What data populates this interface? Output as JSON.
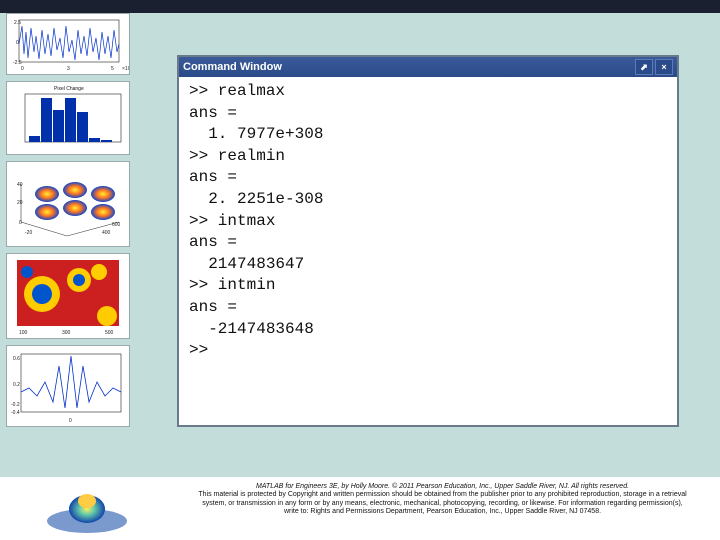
{
  "command_window": {
    "title": "Command Window",
    "dock_label": "⬈",
    "close_label": "×",
    "lines": [
      ">> realmax",
      "ans =",
      "  1. 7977e+308",
      ">> realmin",
      "ans =",
      "  2. 2251e-308",
      ">> intmax",
      "ans =",
      "  2147483647",
      ">> intmin",
      "ans =",
      "  -2147483648",
      ">>"
    ]
  },
  "footer": {
    "book": "MATLAB for Engineers 3E, by Holly Moore. © 2011 Pearson Education, Inc., Upper Saddle River, NJ. All rights reserved.",
    "line2": "This material is protected by Copyright and written permission should be obtained from the publisher prior to any prohibited reproduction, storage in a retrieval",
    "line3": "system, or transmission in any form or by any means, electronic, mechanical, photocopying, recording, or likewise. For information regarding permission(s),",
    "line4": "write to: Rights and Permissions Department, Pearson Education, Inc., Upper Saddle River, NJ 07458."
  },
  "thumbs": {
    "t2_title": "Pixel Change"
  }
}
